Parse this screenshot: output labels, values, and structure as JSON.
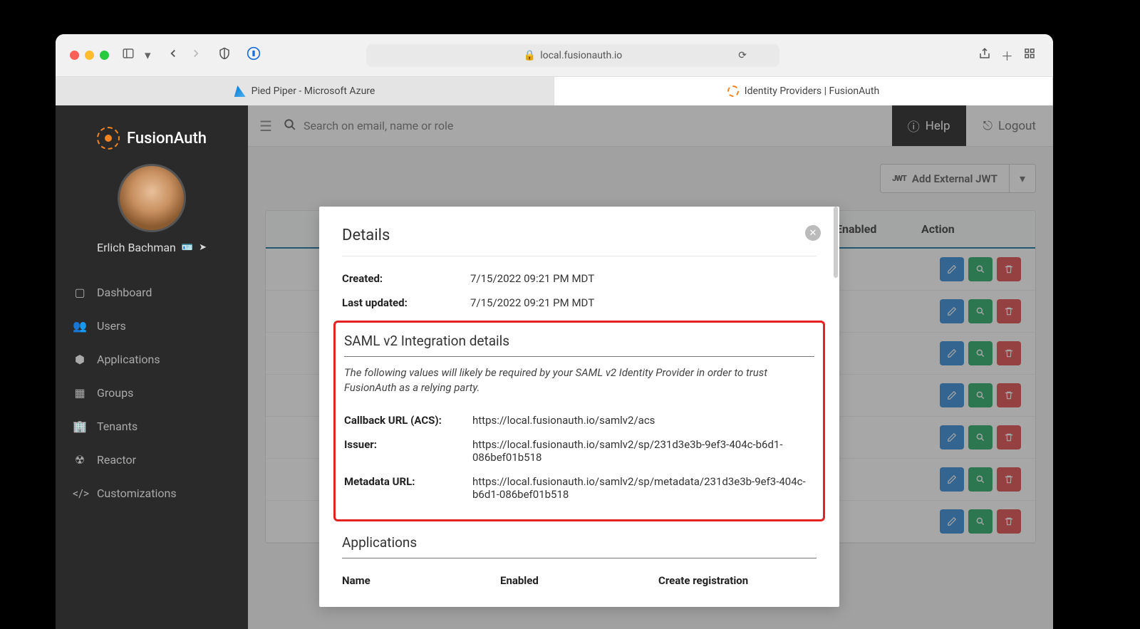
{
  "browser": {
    "url_host": "local.fusionauth.io",
    "tabs": [
      {
        "label": "Pied Piper - Microsoft Azure"
      },
      {
        "label": "Identity Providers | FusionAuth"
      }
    ]
  },
  "sidebar": {
    "logo_text": "FusionAuth",
    "username": "Erlich Bachman",
    "items": [
      {
        "icon": "dashboard",
        "label": "Dashboard"
      },
      {
        "icon": "users",
        "label": "Users"
      },
      {
        "icon": "applications",
        "label": "Applications"
      },
      {
        "icon": "groups",
        "label": "Groups"
      },
      {
        "icon": "tenants",
        "label": "Tenants"
      },
      {
        "icon": "reactor",
        "label": "Reactor"
      },
      {
        "icon": "customizations",
        "label": "Customizations"
      }
    ]
  },
  "topbar": {
    "search_placeholder": "Search on email, name or role",
    "help": "Help",
    "logout": "Logout"
  },
  "actions": {
    "add_external_jwt": "Add External JWT"
  },
  "table": {
    "col_enabled": "Enabled",
    "col_action": "Action",
    "row_count": 7
  },
  "modal": {
    "title": "Details",
    "created_label": "Created:",
    "created_value": "7/15/2022 09:21 PM MDT",
    "updated_label": "Last updated:",
    "updated_value": "7/15/2022 09:21 PM MDT",
    "saml_title": "SAML v2 Integration details",
    "saml_hint": "The following values will likely be required by your SAML v2 Identity Provider in order to trust FusionAuth as a relying party.",
    "callback_label": "Callback URL (ACS):",
    "callback_value": "https://local.fusionauth.io/samlv2/acs",
    "issuer_label": "Issuer:",
    "issuer_value": "https://local.fusionauth.io/samlv2/sp/231d3e3b-9ef3-404c-b6d1-086bef01b518",
    "metadata_label": "Metadata URL:",
    "metadata_value": "https://local.fusionauth.io/samlv2/sp/metadata/231d3e3b-9ef3-404c-b6d1-086bef01b518",
    "apps_title": "Applications",
    "apps_col_name": "Name",
    "apps_col_enabled": "Enabled",
    "apps_col_create": "Create registration"
  }
}
